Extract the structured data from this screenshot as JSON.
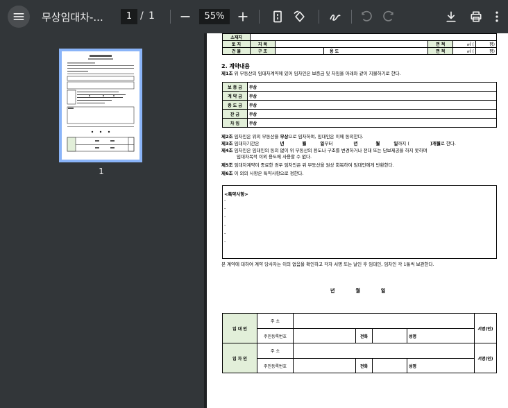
{
  "toolbar": {
    "title": "무상임대차-...",
    "current_page": "1",
    "page_separator": "/",
    "total_pages": "1",
    "zoom": "55%"
  },
  "sidebar": {
    "thumbnail_label": "1"
  },
  "document": {
    "top_table": {
      "row0_label": "소재지",
      "row1": [
        "토 지",
        "지 목",
        "면 적",
        "㎡ (",
        "평)"
      ],
      "row2": [
        "건 물",
        "구 조",
        "용 도",
        "면 적",
        "㎡ (",
        "평)"
      ]
    },
    "section_title": "2. 계약내용",
    "art1": {
      "num": "제1조",
      "text": " 위 부동산의 임대차계약에 있어 임차인은 보증금 및 차임을 아래와 같이 지불하기로 한다."
    },
    "money_rows": [
      {
        "label": "보 증 금",
        "value": "무상"
      },
      {
        "label": "계 약 금",
        "value": "무상"
      },
      {
        "label": "중 도 금",
        "value": "무상"
      },
      {
        "label": "잔 금",
        "value": "무상"
      },
      {
        "label": "차 임",
        "value": "무상"
      }
    ],
    "art2": {
      "num": "제2조",
      "pre": " 임차인은 위의 부동산을 ",
      "bold": "무상",
      "post": "으로 임차하며, 임대인은 이에 동의한다."
    },
    "art3": {
      "num": "제3조",
      "pre": " 임대차기간은",
      "y1": "년",
      "m1": "월",
      "d1": "일",
      "mid": "부터",
      "y2": "년",
      "m2": "월",
      "d2": "일",
      "mid2": "까지 (",
      "bold": ")개월",
      "post": "로 한다."
    },
    "art4": {
      "num": "제4조",
      "line1": " 임차인은 임대인의 동의 없이 위 부동산의 용도나 구조를 변경하거나 전대 또는 담보제공을 하지 못하며",
      "line2": "임대차목적 이외 용도에 사용할 수 없다."
    },
    "art5": {
      "num": "제5조",
      "text": " 임대차계약이 종료한 경우 임차인은 위 부동산을 원상 회복하여 임대인에게 반환한다."
    },
    "art6": {
      "num": "제6조",
      "text": " 이 외의 사항은 특약사항으로 정한다."
    },
    "special": {
      "title": "<특약사항>",
      "lines": [
        "-",
        "-",
        "-",
        "-",
        "-",
        "-"
      ]
    },
    "closing": "본 계약에 대하여 계약 당사자는 이의 없음을 확인하고 각자 서명 또는 날인 후 임대인, 임차인 각 1통씩 보관한다.",
    "date": {
      "y": "년",
      "m": "월",
      "d": "일"
    },
    "parties": [
      {
        "role": "임 대 인",
        "addr_label": "주 소",
        "id_label": "주민등록번호",
        "phone_label": "전화",
        "name_label": "성명",
        "sign": "서명(인)"
      },
      {
        "role": "임 차 인",
        "addr_label": "주 소",
        "id_label": "주민등록번호",
        "phone_label": "전화",
        "name_label": "성명",
        "sign": "서명(인)"
      }
    ]
  },
  "colors": {
    "toolbar_bg": "#323639",
    "viewer_bg": "#525659",
    "thumb_border": "#8ab4f8",
    "cell_green": "#e2efd9"
  }
}
